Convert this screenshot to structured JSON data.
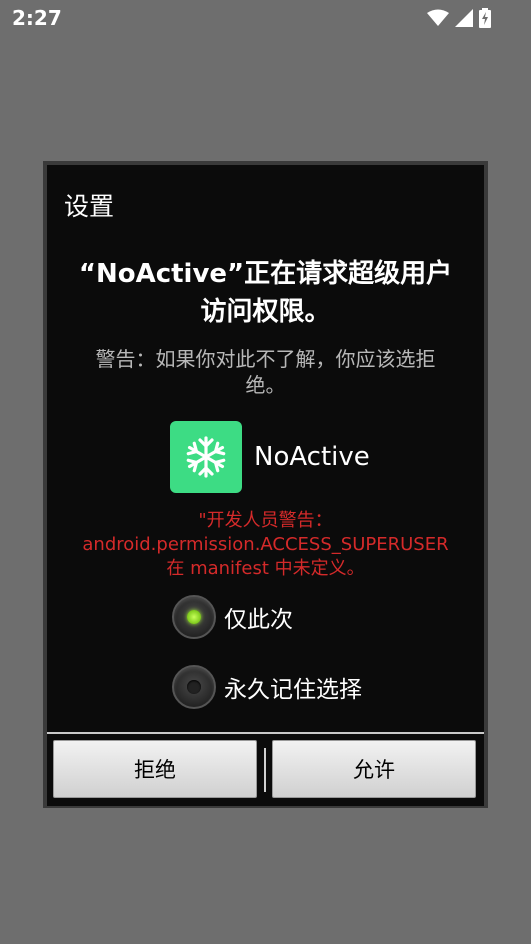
{
  "status_bar": {
    "time": "2:27",
    "icons": [
      "wifi-icon",
      "cellular-signal-icon",
      "battery-charging-icon"
    ]
  },
  "dialog": {
    "title": "设置",
    "headline": "“NoActive”正在请求超级用户访问权限。",
    "warning": "警告：如果你对此不了解，你应该选拒绝。",
    "app": {
      "name": "NoActive",
      "icon": "snowflake-icon",
      "icon_bg": "#3ddc84"
    },
    "dev_warning": "\"开发人员警告：\nandroid.permission.ACCESS_SUPERUSER\n在 manifest 中未定义。",
    "options": [
      {
        "label": "仅此次",
        "checked": true
      },
      {
        "label": "永久记住选择",
        "checked": false
      }
    ],
    "buttons": {
      "deny": "拒绝",
      "allow": "允许"
    }
  },
  "colors": {
    "backdrop": "#6e6e6e",
    "dialog_bg": "#0b0b0b",
    "dev_warning": "#d42a2a"
  }
}
